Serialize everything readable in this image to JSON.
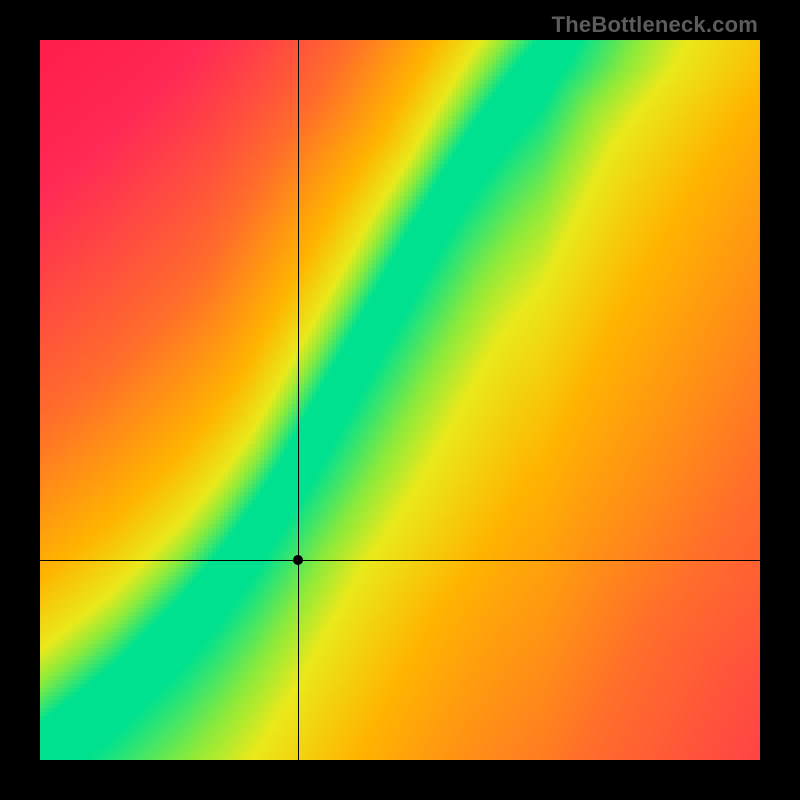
{
  "attribution": {
    "text": "TheBottleneck.com"
  },
  "chart_data": {
    "type": "heatmap",
    "title": "",
    "xlabel": "",
    "ylabel": "",
    "xlim": [
      0,
      1
    ],
    "ylim": [
      0,
      1
    ],
    "grid": false,
    "legend": null,
    "annotations": [],
    "marker": {
      "x": 0.359,
      "y": 0.278
    },
    "crosshair": {
      "x": 0.359,
      "y": 0.278
    },
    "band": {
      "description": "Green sweet-spot band; points on this curve map x→y. Band drawn with given half-width (in x units) around the center curve; everything outside fades through yellow→orange→red.",
      "curve_x": [
        0.0,
        0.05,
        0.1,
        0.15,
        0.2,
        0.25,
        0.3,
        0.35,
        0.4,
        0.45,
        0.5,
        0.55,
        0.6,
        0.65,
        0.7,
        0.72
      ],
      "curve_y": [
        0.0,
        0.04,
        0.08,
        0.13,
        0.18,
        0.24,
        0.31,
        0.39,
        0.48,
        0.57,
        0.66,
        0.75,
        0.83,
        0.9,
        0.96,
        1.0
      ],
      "half_width_x": 0.03
    },
    "color_stops": {
      "description": "Piecewise color ramp keyed by normalized distance d (0 at band center, 1 at farthest corner).",
      "stops": [
        {
          "d": 0.0,
          "hex": "#00e18f"
        },
        {
          "d": 0.06,
          "hex": "#8bea3b"
        },
        {
          "d": 0.11,
          "hex": "#e9e91b"
        },
        {
          "d": 0.22,
          "hex": "#ffb400"
        },
        {
          "d": 0.45,
          "hex": "#ff6e2a"
        },
        {
          "d": 0.8,
          "hex": "#ff2a55"
        },
        {
          "d": 1.0,
          "hex": "#ff1f4c"
        }
      ]
    },
    "resolution": 180
  }
}
